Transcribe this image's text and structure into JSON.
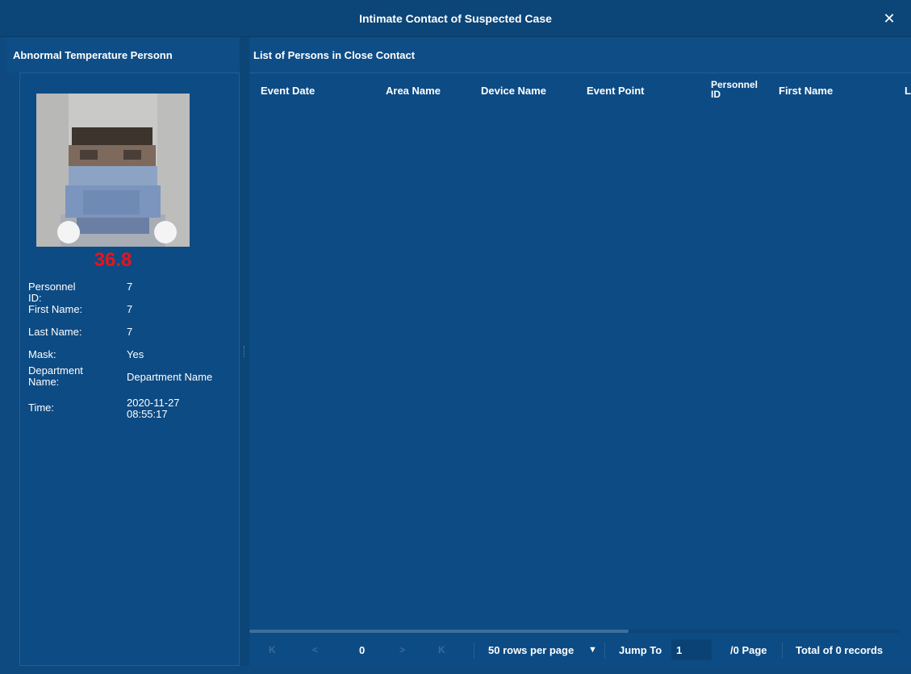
{
  "window": {
    "title": "Intimate Contact of Suspected Case",
    "close_glyph": "✕"
  },
  "left": {
    "title": "Abnormal Temperature Personn",
    "temperature": "36.8",
    "fields": [
      {
        "label": "Personnel ID:",
        "value": "7"
      },
      {
        "label": "First Name:",
        "value": "7"
      },
      {
        "label": "Last Name:",
        "value": "7"
      },
      {
        "label": "Mask:",
        "value": "Yes"
      },
      {
        "label": "Department Name:",
        "value": "Department Name"
      },
      {
        "label": "Time:",
        "value": "2020-11-27 08:55:17"
      }
    ],
    "time_date": "2020-11-27",
    "time_clock": "08:55:17",
    "dept_label_1": "Department",
    "dept_label_2": "Name:"
  },
  "right": {
    "title": "List of Persons in Close Contact",
    "columns": [
      "Event Date",
      "Area Name",
      "Device Name",
      "Event Point",
      "Personnel ID",
      "First Name",
      "L"
    ],
    "personnel_1": "Personnel",
    "personnel_2": "ID",
    "rows": []
  },
  "pager": {
    "first_glyph": "K",
    "prev_glyph": "<",
    "current_page": "0",
    "next_glyph": ">",
    "last_glyph": "K",
    "rows_per_page": "50 rows per page",
    "dropdown_glyph": "▼",
    "jump_label": "Jump To",
    "jump_value": "1",
    "page_total": "/0 Page",
    "records": "Total of 0 records"
  },
  "colors": {
    "background": "#0e4a80",
    "temperature": "#e8141c"
  }
}
